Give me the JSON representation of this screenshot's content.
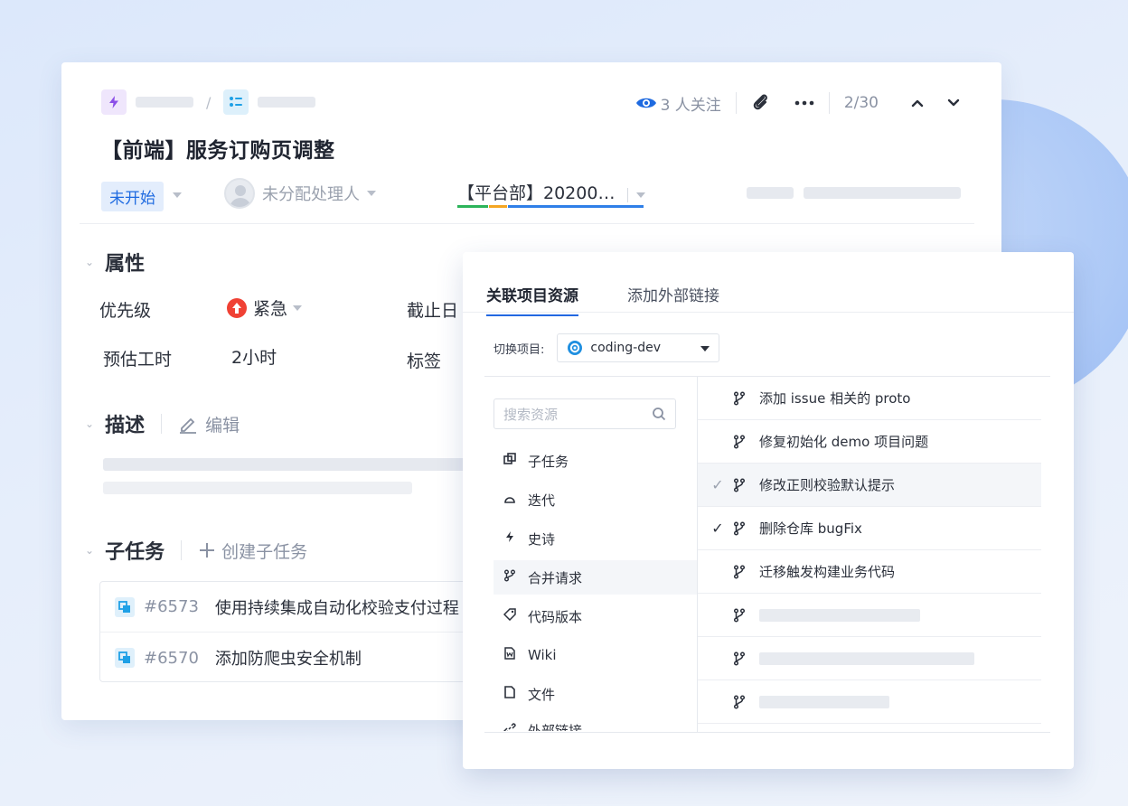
{
  "header": {
    "watchers_text": "3 人关注",
    "pager": "2/30"
  },
  "issue": {
    "title": "【前端】服务订购页调整",
    "status": "未开始",
    "assignee": "未分配处理人",
    "iteration": "【平台部】20200…"
  },
  "attributes": {
    "section_title": "属性",
    "priority_label": "优先级",
    "priority_value": "紧急",
    "deadline_label": "截止日",
    "estimate_label": "预估工时",
    "estimate_value": "2小时",
    "tags_label": "标签"
  },
  "description": {
    "section_title": "描述",
    "edit_label": "编辑"
  },
  "subtasks": {
    "section_title": "子任务",
    "create_label": "创建子任务",
    "items": [
      {
        "id": "#6573",
        "title": "使用持续集成自动化校验支付过程"
      },
      {
        "id": "#6570",
        "title": "添加防爬虫安全机制"
      }
    ]
  },
  "popup": {
    "tabs": [
      "关联项目资源",
      "添加外部链接"
    ],
    "switch_project_label": "切换项目:",
    "project_value": "coding-dev",
    "search_placeholder": "搜索资源",
    "categories": [
      "子任务",
      "迭代",
      "史诗",
      "合并请求",
      "代码版本",
      "Wiki",
      "文件",
      "外部链接"
    ],
    "resources": [
      {
        "title": "添加 issue 相关的 proto",
        "checked": false,
        "highlight": false
      },
      {
        "title": "修复初始化 demo 项目问题",
        "checked": false,
        "highlight": false
      },
      {
        "title": "修改正则校验默认提示",
        "checked": true,
        "highlight": true
      },
      {
        "title": "删除仓库 bugFix",
        "checked": true,
        "highlight": false
      },
      {
        "title": "迁移触发构建业务代码",
        "checked": false,
        "highlight": false
      }
    ]
  },
  "colors": {
    "accent": "#2368e1",
    "status_badge_bg": "#e3edfc",
    "priority_red": "#f04134"
  }
}
